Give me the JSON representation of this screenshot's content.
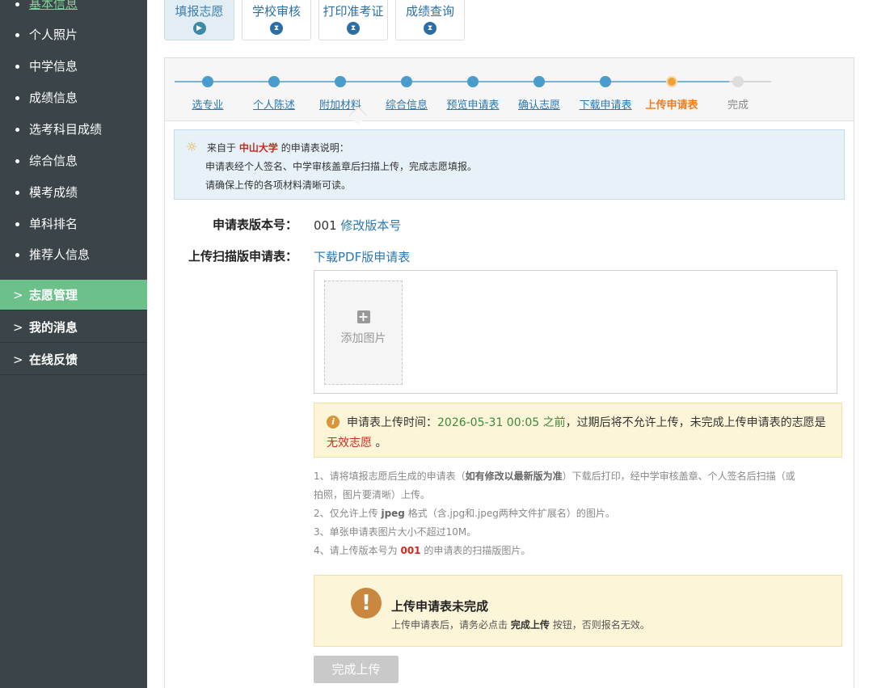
{
  "sidebar": {
    "sub_items": [
      "基本信息",
      "个人照片",
      "中学信息",
      "成绩信息",
      "选考科目成绩",
      "综合信息",
      "模考成绩",
      "单科排名",
      "推荐人信息"
    ],
    "main_items": [
      "志愿管理",
      "我的消息",
      "在线反馈"
    ],
    "chevron": ">"
  },
  "tabs": [
    "填报志愿",
    "学校审核",
    "打印准考证",
    "成绩查询"
  ],
  "tab_icons": {
    "active": "▶",
    "pending": "⧗"
  },
  "steps": [
    "选专业",
    "个人陈述",
    "附加材料",
    "综合信息",
    "预览申请表",
    "确认志愿",
    "下载申请表",
    "上传申请表",
    "完成"
  ],
  "info": {
    "prefix": "来自于",
    "university": "中山大学",
    "suffix": "的申请表说明：",
    "line2": "申请表经个人签名、中学审核盖章后扫描上传，完成志愿填报。",
    "line3": "请确保上传的各项材料清晰可读。",
    "icon": "bulb-icon"
  },
  "form": {
    "version_label": "申请表版本号：",
    "version_value": "001",
    "version_link": "修改版本号",
    "upload_label": "上传扫描版申请表：",
    "download_link": "下载PDF版申请表",
    "add_image": "添加图片"
  },
  "warning": {
    "prefix": "申请表上传时间：",
    "deadline": "2026-05-31 00:05 之前",
    "rest": "，过期后将不允许上传，未完成上传申请表的志愿是",
    "invalid": "无效志愿",
    "end": "。"
  },
  "notes": {
    "n1a": "1、请将填报志愿后生成的申请表（",
    "n1b": "如有修改以最新版为准",
    "n1c": "）下载后打印，经中学审核盖章、个人签名后扫描（或",
    "n1d": "拍照，图片要清晰）上传。",
    "n2a": "2、仅允许上传",
    "n2b": "jpeg",
    "n2c": "格式（含.jpg和.jpeg两种文件扩展名）的图片。",
    "n3": "3、单张申请表图片大小不超过10M。",
    "n4a": "4、请上传版本号为",
    "n4b": "001",
    "n4c": "的申请表的扫描版图片。"
  },
  "alert": {
    "title": "上传申请表未完成",
    "text_a": "上传申请表后，请务必点击",
    "text_b": "完成上传",
    "text_c": "按钮，否则报名无效。"
  },
  "done_button": "完成上传",
  "colors": {
    "sidebar_bg": "#3b4448",
    "active_green": "#6cc08a",
    "link_blue": "#2b77b4",
    "current_step_orange": "#ee7d21",
    "warning_red": "#d4291c"
  }
}
